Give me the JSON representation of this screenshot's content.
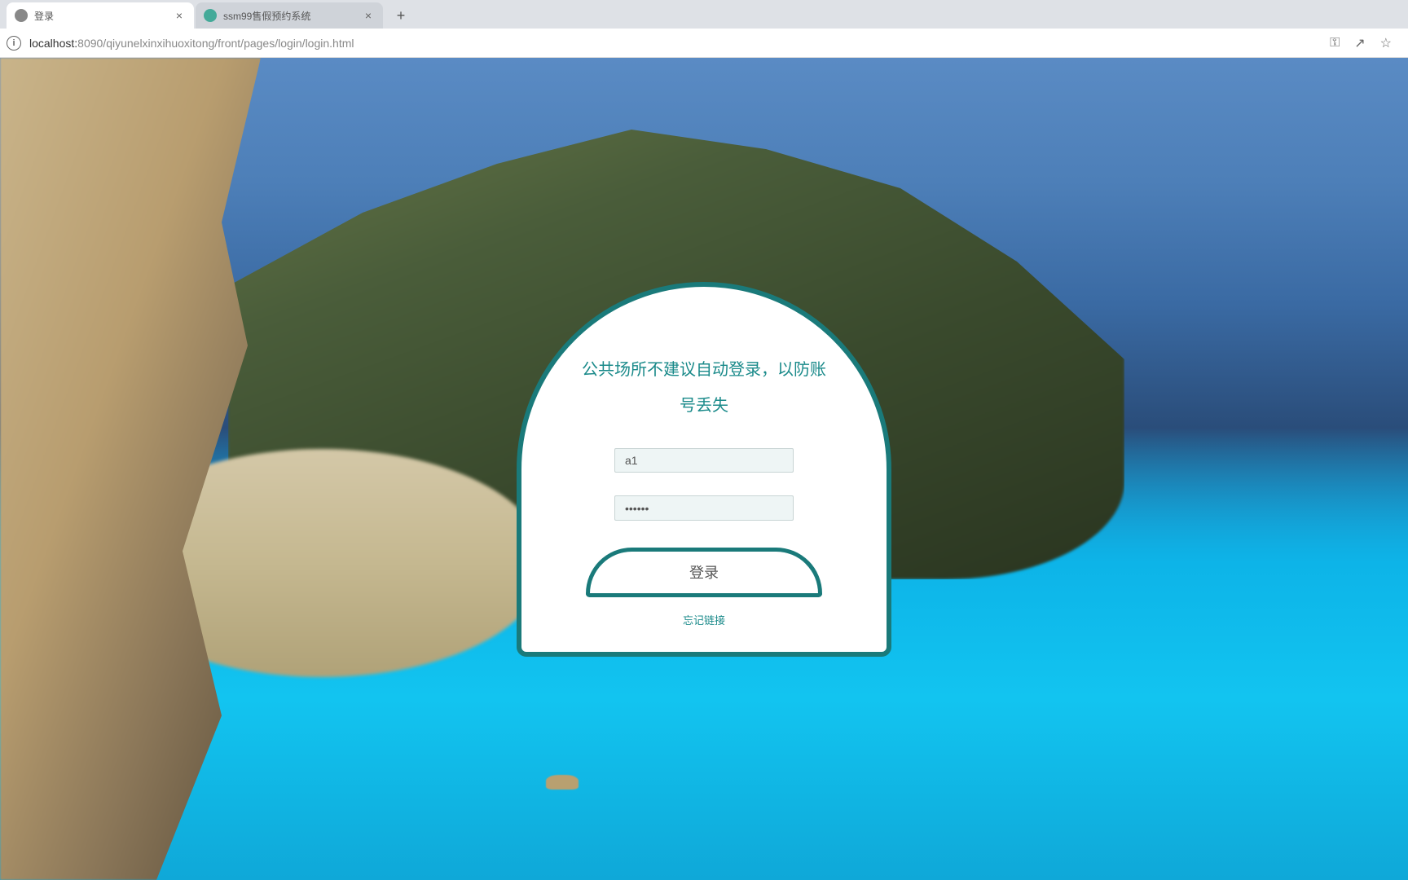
{
  "browser": {
    "tabs": [
      {
        "title": "登录",
        "active": true
      },
      {
        "title": "ssm99售假预约系统",
        "active": false
      }
    ],
    "url_host": "localhost:",
    "url_path": "8090/qiyunelxinxihuoxitong/front/pages/login/login.html"
  },
  "login": {
    "notice": "公共场所不建议自动登录，以防账号丢失",
    "username_value": "a1",
    "username_placeholder": "",
    "password_value": "••••••",
    "password_placeholder": "",
    "submit_label": "登录",
    "register_link": "忘记链接"
  }
}
